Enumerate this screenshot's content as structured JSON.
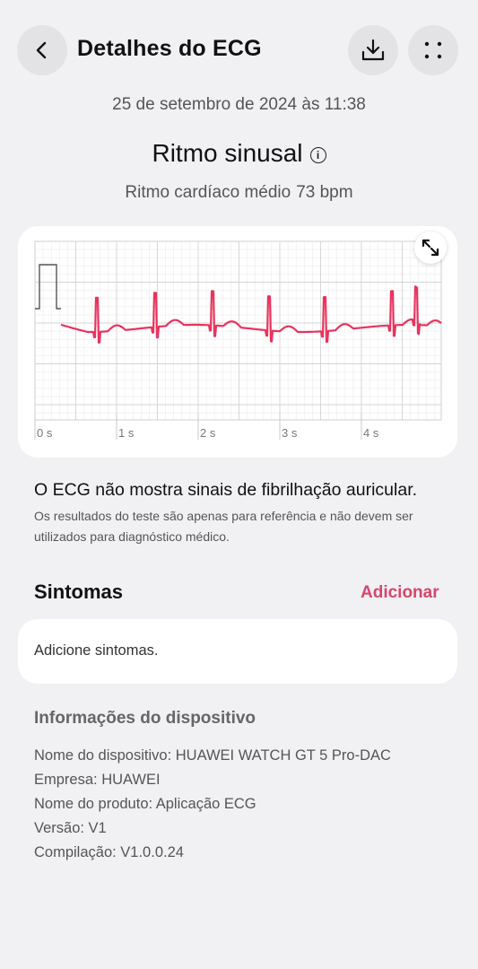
{
  "header": {
    "title": "Detalhes do ECG",
    "back_icon": "chevron-left-icon",
    "download_icon": "download-icon",
    "more_icon": "more-dots-icon"
  },
  "measurement": {
    "datetime": "25 de setembro de 2024 às 11:38",
    "result": "Ritmo sinusal",
    "heart_rate_label": "Ritmo cardíaco médio",
    "heart_rate_value": "73 bpm"
  },
  "ecg_chart": {
    "time_labels": [
      "0 s",
      "1 s",
      "2 s",
      "3 s",
      "4 s"
    ],
    "trace_color": "#e8335e",
    "expand_icon": "expand-icon"
  },
  "analysis": {
    "summary": "O ECG não mostra sinais de fibrilhação auricular.",
    "disclaimer": "Os resultados do teste são apenas para referência e não devem ser utilizados para diagnóstico médico."
  },
  "symptoms": {
    "title": "Sintomas",
    "add_label": "Adicionar",
    "placeholder": "Adicione sintomas."
  },
  "device_info": {
    "title": "Informações do dispositivo",
    "rows": [
      "Nome do dispositivo: HUAWEI WATCH GT 5 Pro-DAC",
      "Empresa: HUAWEI",
      "Nome do produto: Aplicação ECG",
      "Versão: V1",
      "Compilação: V1.0.0.24"
    ]
  },
  "colors": {
    "accent": "#d6466b",
    "background": "#f1f1f3",
    "card": "#ffffff"
  }
}
